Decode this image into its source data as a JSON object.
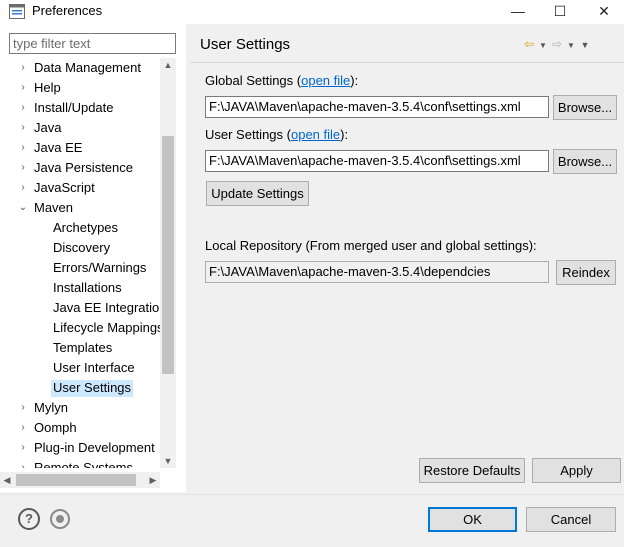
{
  "window": {
    "title": "Preferences",
    "minimize": "—",
    "maximize": "☐",
    "close": "✕"
  },
  "sidebar": {
    "filter_placeholder": "type filter text",
    "items": [
      {
        "label": "Data Management",
        "expander": "›",
        "indent": 0
      },
      {
        "label": "Help",
        "expander": "›",
        "indent": 0
      },
      {
        "label": "Install/Update",
        "expander": "›",
        "indent": 0
      },
      {
        "label": "Java",
        "expander": "›",
        "indent": 0
      },
      {
        "label": "Java EE",
        "expander": "›",
        "indent": 0
      },
      {
        "label": "Java Persistence",
        "expander": "›",
        "indent": 0
      },
      {
        "label": "JavaScript",
        "expander": "›",
        "indent": 0
      },
      {
        "label": "Maven",
        "expander": "⌄",
        "indent": 0
      },
      {
        "label": "Archetypes",
        "expander": "",
        "indent": 1
      },
      {
        "label": "Discovery",
        "expander": "",
        "indent": 1
      },
      {
        "label": "Errors/Warnings",
        "expander": "",
        "indent": 1
      },
      {
        "label": "Installations",
        "expander": "",
        "indent": 1
      },
      {
        "label": "Java EE Integration",
        "expander": "",
        "indent": 1
      },
      {
        "label": "Lifecycle Mappings",
        "expander": "",
        "indent": 1
      },
      {
        "label": "Templates",
        "expander": "",
        "indent": 1
      },
      {
        "label": "User Interface",
        "expander": "",
        "indent": 1
      },
      {
        "label": "User Settings",
        "expander": "",
        "indent": 1,
        "selected": true
      },
      {
        "label": "Mylyn",
        "expander": "›",
        "indent": 0
      },
      {
        "label": "Oomph",
        "expander": "›",
        "indent": 0
      },
      {
        "label": "Plug-in Development",
        "expander": "›",
        "indent": 0
      },
      {
        "label": "Remote Systems",
        "expander": "›",
        "indent": 0
      }
    ]
  },
  "page": {
    "title": "User Settings",
    "global_label": "Global Settings (",
    "global_link": "open file",
    "global_label_end": "):",
    "global_path": "F:\\JAVA\\Maven\\apache-maven-3.5.4\\conf\\settings.xml",
    "user_label": "User Settings (",
    "user_link": "open file",
    "user_label_end": "):",
    "user_path": "F:\\JAVA\\Maven\\apache-maven-3.5.4\\conf\\settings.xml",
    "browse_label": "Browse...",
    "update_label": "Update Settings",
    "local_repo_label": "Local Repository (From merged user and global settings):",
    "local_repo_path": "F:\\JAVA\\Maven\\apache-maven-3.5.4\\dependcies",
    "reindex_label": "Reindex",
    "restore_label": "Restore Defaults",
    "apply_label": "Apply"
  },
  "footer": {
    "ok_label": "OK",
    "cancel_label": "Cancel",
    "help_glyph": "?"
  }
}
